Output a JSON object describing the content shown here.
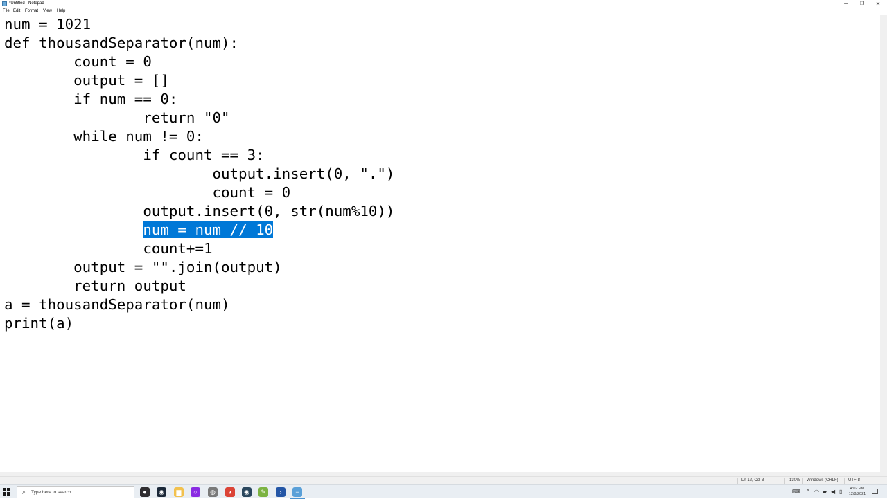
{
  "window": {
    "title": "*Untitled - Notepad",
    "minimize_glyph": "─",
    "maximize_glyph": "❐",
    "close_glyph": "✕"
  },
  "menu": {
    "items": [
      "File",
      "Edit",
      "Format",
      "View",
      "Help"
    ]
  },
  "editor": {
    "lines": [
      "num = 1021",
      "def thousandSeparator(num):",
      "        count = 0",
      "        output = []",
      "        if num == 0:",
      "                return \"0\"",
      "        while num != 0:",
      "                if count == 3:",
      "                        output.insert(0, \".\")",
      "                        count = 0",
      "                output.insert(0, str(num%10))",
      "                ",
      "                count+=1",
      "        output = \"\".join(output)",
      "        return output",
      "a = thousandSeparator(num)",
      "print(a)"
    ],
    "selected_text": "num = num // 10",
    "selection_color": "#0078d7"
  },
  "statusbar": {
    "position": "Ln 12, Col 3",
    "zoom": "130%",
    "line_ending": "Windows (CRLF)",
    "encoding": "UTF-8"
  },
  "taskbar": {
    "search_placeholder": "Type here to search",
    "search_glyph": "⌕",
    "time": "4:02 PM",
    "date": "12/8/2021",
    "apps": [
      {
        "name": "obs-icon",
        "glyph": "●",
        "color": "#302e31"
      },
      {
        "name": "steam-icon",
        "glyph": "◉",
        "color": "#1b2838"
      },
      {
        "name": "file-explorer-icon",
        "glyph": "▆",
        "color": "#f2c14e"
      },
      {
        "name": "cortana-icon",
        "glyph": "○",
        "color": "#8a2be2"
      },
      {
        "name": "gamepad-icon",
        "glyph": "◍",
        "color": "#7a7a7a"
      },
      {
        "name": "chrome-icon",
        "glyph": "◕",
        "color": "#db4437"
      },
      {
        "name": "steam-app-icon",
        "glyph": "◉",
        "color": "#2a475e"
      },
      {
        "name": "notepadpp-icon",
        "glyph": "✎",
        "color": "#7cb342"
      },
      {
        "name": "powershell-icon",
        "glyph": "›",
        "color": "#2456a6"
      },
      {
        "name": "notepad-icon",
        "glyph": "≡",
        "color": "#5aa0d8"
      }
    ],
    "tray": [
      {
        "name": "keyboard-icon",
        "glyph": "⌨"
      },
      {
        "name": "chevron-up-icon",
        "glyph": "^"
      },
      {
        "name": "network-icon",
        "glyph": "◠"
      },
      {
        "name": "dropbox-icon",
        "glyph": "▰"
      },
      {
        "name": "volume-icon",
        "glyph": "◀"
      },
      {
        "name": "battery-icon",
        "glyph": "▯"
      }
    ]
  }
}
